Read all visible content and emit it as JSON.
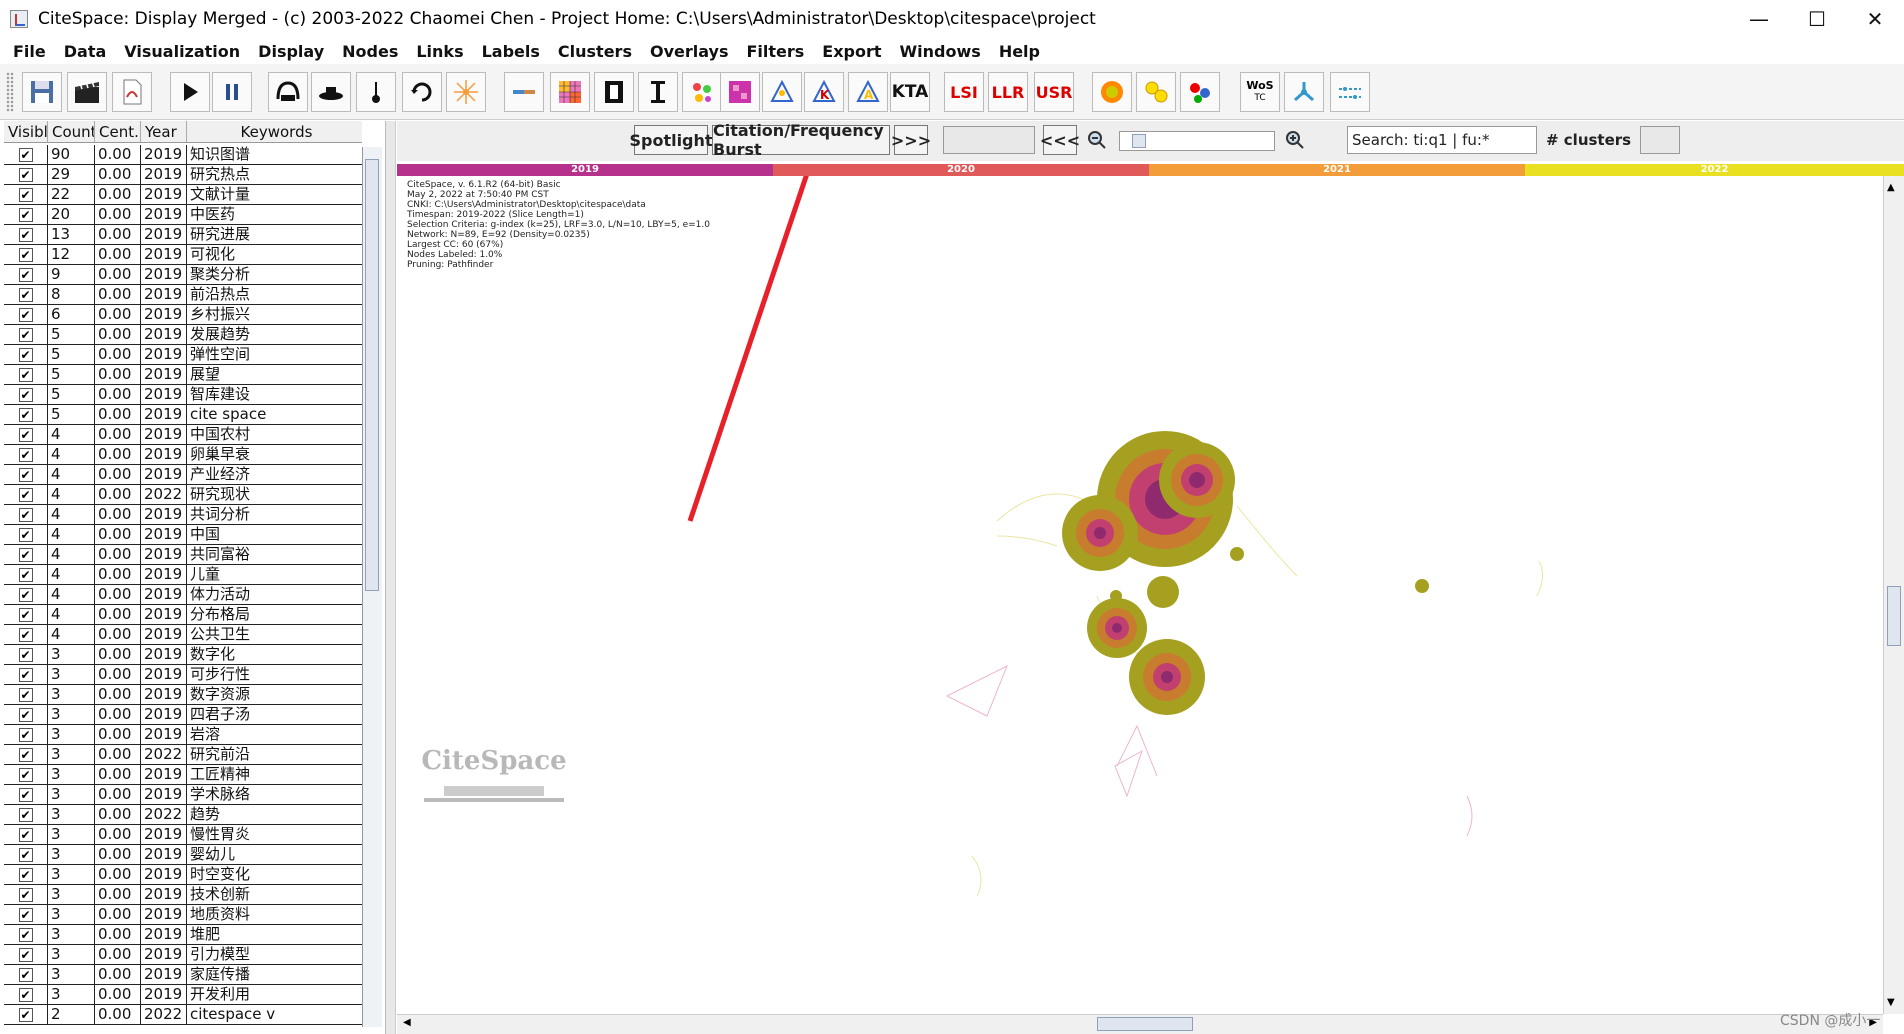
{
  "window": {
    "title": "CiteSpace: Display Merged - (c) 2003-2022 Chaomei Chen - Project Home: C:\\Users\\Administrator\\Desktop\\citespace\\project",
    "min": "—",
    "max": "☐",
    "close": "✕"
  },
  "menu": [
    "File",
    "Data",
    "Visualization",
    "Display",
    "Nodes",
    "Links",
    "Labels",
    "Clusters",
    "Overlays",
    "Filters",
    "Export",
    "Windows",
    "Help"
  ],
  "toolbar": {
    "lsi": "LSI",
    "llr": "LLR",
    "usr": "USR",
    "wos": "WoS",
    "wos_sub": "TC",
    "kta": "KTA"
  },
  "table": {
    "headers": [
      "Visible",
      "Count",
      "Cent..",
      "Year",
      "Keywords"
    ],
    "rows": [
      [
        "90",
        "0.00",
        "2019",
        "知识图谱"
      ],
      [
        "29",
        "0.00",
        "2019",
        "研究热点"
      ],
      [
        "22",
        "0.00",
        "2019",
        "文献计量"
      ],
      [
        "20",
        "0.00",
        "2019",
        "中医药"
      ],
      [
        "13",
        "0.00",
        "2019",
        "研究进展"
      ],
      [
        "12",
        "0.00",
        "2019",
        "可视化"
      ],
      [
        "9",
        "0.00",
        "2019",
        "聚类分析"
      ],
      [
        "8",
        "0.00",
        "2019",
        "前沿热点"
      ],
      [
        "6",
        "0.00",
        "2019",
        "乡村振兴"
      ],
      [
        "5",
        "0.00",
        "2019",
        "发展趋势"
      ],
      [
        "5",
        "0.00",
        "2019",
        "弹性空间"
      ],
      [
        "5",
        "0.00",
        "2019",
        "展望"
      ],
      [
        "5",
        "0.00",
        "2019",
        "智库建设"
      ],
      [
        "5",
        "0.00",
        "2019",
        "cite space"
      ],
      [
        "4",
        "0.00",
        "2019",
        "中国农村"
      ],
      [
        "4",
        "0.00",
        "2019",
        "卵巢早衰"
      ],
      [
        "4",
        "0.00",
        "2019",
        "产业经济"
      ],
      [
        "4",
        "0.00",
        "2022",
        "研究现状"
      ],
      [
        "4",
        "0.00",
        "2019",
        "共词分析"
      ],
      [
        "4",
        "0.00",
        "2019",
        "中国"
      ],
      [
        "4",
        "0.00",
        "2019",
        "共同富裕"
      ],
      [
        "4",
        "0.00",
        "2019",
        "儿童"
      ],
      [
        "4",
        "0.00",
        "2019",
        "体力活动"
      ],
      [
        "4",
        "0.00",
        "2019",
        "分布格局"
      ],
      [
        "4",
        "0.00",
        "2019",
        "公共卫生"
      ],
      [
        "3",
        "0.00",
        "2019",
        "数字化"
      ],
      [
        "3",
        "0.00",
        "2019",
        "可步行性"
      ],
      [
        "3",
        "0.00",
        "2019",
        "数字资源"
      ],
      [
        "3",
        "0.00",
        "2019",
        "四君子汤"
      ],
      [
        "3",
        "0.00",
        "2019",
        "岩溶"
      ],
      [
        "3",
        "0.00",
        "2022",
        "研究前沿"
      ],
      [
        "3",
        "0.00",
        "2019",
        "工匠精神"
      ],
      [
        "3",
        "0.00",
        "2019",
        "学术脉络"
      ],
      [
        "3",
        "0.00",
        "2022",
        "趋势"
      ],
      [
        "3",
        "0.00",
        "2019",
        "慢性胃炎"
      ],
      [
        "3",
        "0.00",
        "2019",
        "婴幼儿"
      ],
      [
        "3",
        "0.00",
        "2019",
        "时空变化"
      ],
      [
        "3",
        "0.00",
        "2019",
        "技术创新"
      ],
      [
        "3",
        "0.00",
        "2019",
        "地质资料"
      ],
      [
        "3",
        "0.00",
        "2019",
        "堆肥"
      ],
      [
        "3",
        "0.00",
        "2019",
        "引力模型"
      ],
      [
        "3",
        "0.00",
        "2019",
        "家庭传播"
      ],
      [
        "3",
        "0.00",
        "2019",
        "开发利用"
      ],
      [
        "2",
        "0.00",
        "2022",
        "citespace v"
      ]
    ]
  },
  "controls": {
    "spotlight": "Spotlight",
    "burst": "Citation/Frequency Burst",
    "next": ">>>",
    "prev": "<<<",
    "search": "Search: ti:q1 | fu:*",
    "clusters": "# clusters"
  },
  "timeline": [
    {
      "label": "2019",
      "color": "#b5318c"
    },
    {
      "label": "2020",
      "color": "#e05a5a"
    },
    {
      "label": "2021",
      "color": "#f39c3a"
    },
    {
      "label": "2022",
      "color": "#e8e020"
    }
  ],
  "info": [
    "CiteSpace, v. 6.1.R2 (64-bit) Basic",
    "May 2, 2022 at 7:50:40 PM CST",
    "CNKI: C:\\Users\\Administrator\\Desktop\\citespace\\data",
    "Timespan: 2019-2022 (Slice Length=1)",
    "Selection Criteria: g-index (k=25), LRF=3.0, L/N=10, LBY=5, e=1.0",
    "Network: N=89, E=92 (Density=0.0235)",
    "Largest CC: 60 (67%)",
    "Nodes Labeled: 1.0%",
    "Pruning: Pathfinder"
  ],
  "logo": "CiteSpace",
  "watermark": "CSDN @成小一"
}
